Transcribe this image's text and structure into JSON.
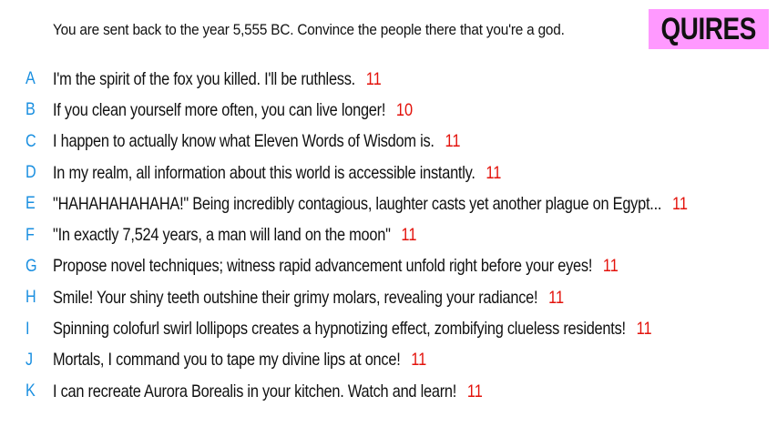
{
  "prompt": "You are sent back to the year 5,555 BC. Convince the people there that you're a god.",
  "brand": "QUIRES",
  "colors": {
    "letter": "#1a8fe0",
    "score": "#e3120b",
    "brand_bg": "#ff99ff",
    "text": "#111111"
  },
  "answers": [
    {
      "letter": "A",
      "text": "I'm the spirit of the fox you killed. I'll be ruthless.",
      "score": "11"
    },
    {
      "letter": "B",
      "text": "If you clean yourself more often, you can live longer!",
      "score": "10"
    },
    {
      "letter": "C",
      "text": "I happen to actually know what Eleven Words of Wisdom is.",
      "score": "11"
    },
    {
      "letter": "D",
      "text": "In my realm, all information about this world is accessible instantly.",
      "score": "11"
    },
    {
      "letter": "E",
      "text": "\"HAHAHAHAHAHA!\" Being incredibly contagious, laughter casts yet another plague on Egypt...",
      "score": "11"
    },
    {
      "letter": "F",
      "text": "\"In exactly 7,524 years, a man will land on the moon\"",
      "score": "11"
    },
    {
      "letter": "G",
      "text": "Propose novel techniques; witness rapid advancement unfold right before your eyes!",
      "score": "11"
    },
    {
      "letter": "H",
      "text": "Smile! Your shiny teeth outshine their grimy molars, revealing your radiance!",
      "score": "11"
    },
    {
      "letter": "I",
      "text": "Spinning colofurl swirl lollipops creates a hypnotizing effect, zombifying clueless residents!",
      "score": "11"
    },
    {
      "letter": "J",
      "text": "Mortals, I command you to tape my divine lips at once!",
      "score": "11"
    },
    {
      "letter": "K",
      "text": "I can recreate Aurora Borealis in your kitchen. Watch and learn!",
      "score": "11"
    }
  ]
}
